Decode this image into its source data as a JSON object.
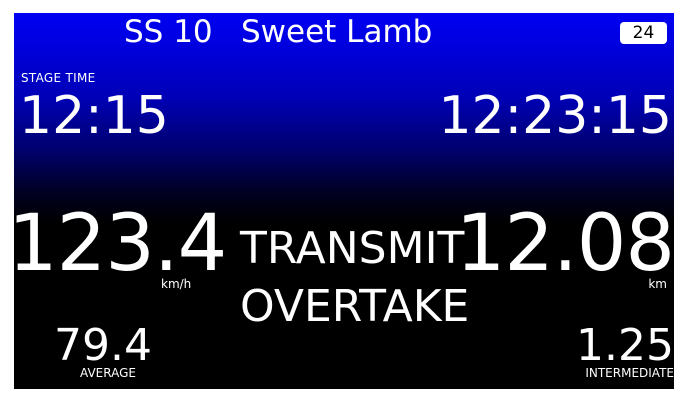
{
  "header": {
    "stage_id": "SS 10",
    "stage_name": "Sweet Lamb",
    "badge": "24"
  },
  "stage_time": {
    "label": "STAGE TIME",
    "value": "12:15"
  },
  "clock": {
    "value": "12:23:15"
  },
  "speed": {
    "value": "123.4",
    "unit": "km/h"
  },
  "messages": {
    "line1": "TRANSMIT",
    "line2": "OVERTAKE"
  },
  "distance": {
    "value": "12.08",
    "unit": "km"
  },
  "average": {
    "value": "79.4",
    "label": "AVERAGE"
  },
  "intermediate": {
    "value": "1.25",
    "label": "INTERMEDIATE"
  },
  "colors": {
    "top_background": "#0000f2",
    "bottom_background": "#000000",
    "text": "#ffffff"
  }
}
